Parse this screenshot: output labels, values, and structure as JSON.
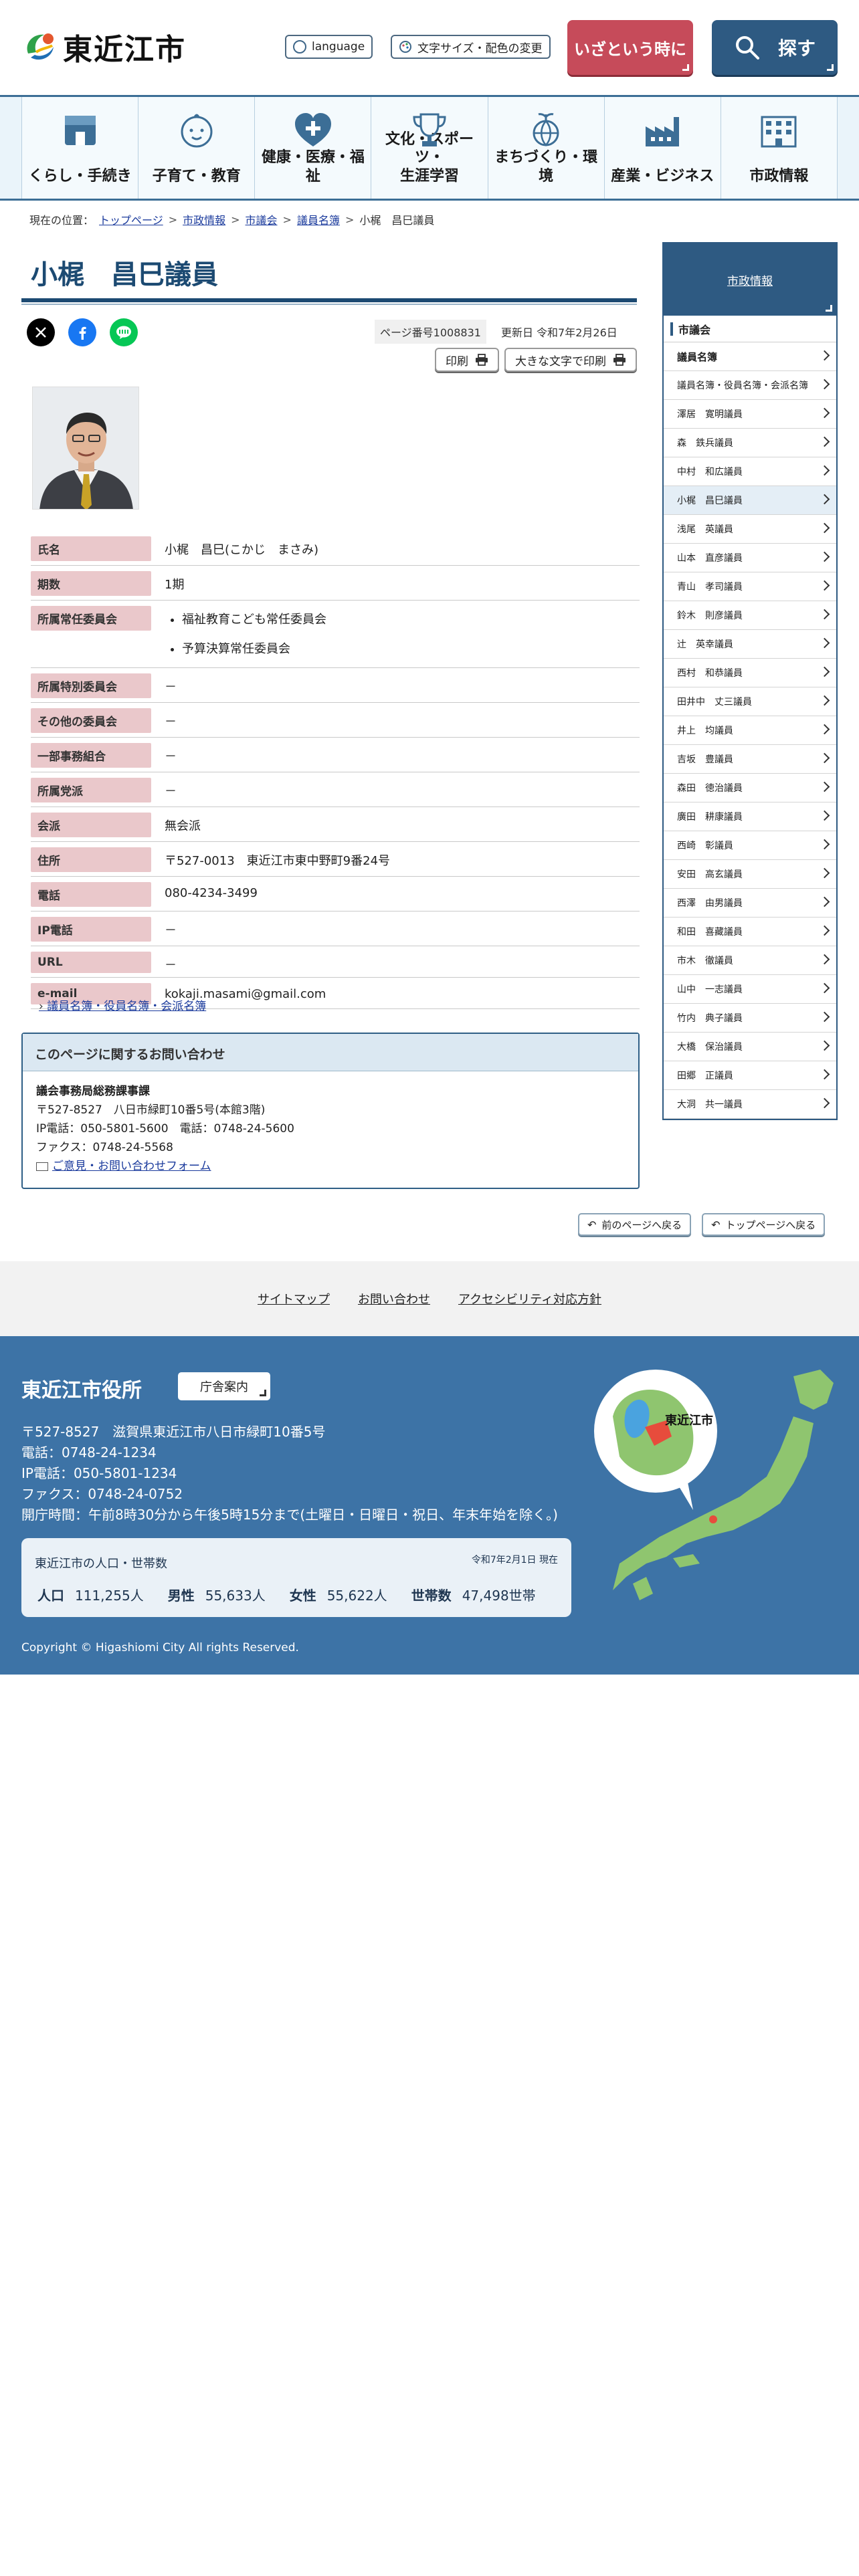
{
  "header": {
    "logo_text": "東近江市",
    "language_label": "language",
    "fontsize_label": "文字サイズ・配色の変更",
    "emergency_label": "いざという時に",
    "search_label": "探す"
  },
  "gnav": [
    {
      "label": "くらし・手続き",
      "icon": "house-icon"
    },
    {
      "label": "子育て・教育",
      "icon": "baby-face-icon"
    },
    {
      "label": "健康・医療・福祉",
      "icon": "heart-plus-icon"
    },
    {
      "label": "文化・スポーツ・\n生涯学習",
      "icon": "trophy-icon"
    },
    {
      "label": "まちづくり・環境",
      "icon": "globe-plant-icon"
    },
    {
      "label": "産業・ビジネス",
      "icon": "factory-icon"
    },
    {
      "label": "市政情報",
      "icon": "building-icon"
    }
  ],
  "breadcrumb": {
    "prefix": "現在の位置：",
    "items": [
      "トップページ",
      "市政情報",
      "市議会",
      "議員名簿"
    ],
    "current": "小梶　昌巳議員"
  },
  "page": {
    "title": "小梶　昌巳議員",
    "page_number": "ページ番号1008831",
    "updated": "更新日 令和7年2月26日",
    "print_label": "印刷",
    "print_large_label": "大きな文字で印刷"
  },
  "profile": [
    {
      "label": "氏名",
      "value": "小梶　昌巳(こかじ　まさみ)"
    },
    {
      "label": "期数",
      "value": "1期"
    },
    {
      "label": "所属常任委員会",
      "list": [
        "福祉教育こども常任委員会",
        "予算決算常任委員会"
      ]
    },
    {
      "label": "所属特別委員会",
      "value": "－"
    },
    {
      "label": "その他の委員会",
      "value": "－"
    },
    {
      "label": "一部事務組合",
      "value": "－"
    },
    {
      "label": "所属党派",
      "value": "－"
    },
    {
      "label": "会派",
      "value": "無会派"
    },
    {
      "label": "住所",
      "value": "〒527-0013　東近江市東中野町9番24号"
    },
    {
      "label": "電話",
      "value": "080-4234-3499"
    },
    {
      "label": "IP電話",
      "value": "－"
    },
    {
      "label": "URL",
      "value": "－"
    },
    {
      "label": "e-mail",
      "value": "kokaji.masami@gmail.com"
    }
  ],
  "related_link": "議員名簿・役員名簿・会派名簿",
  "contact": {
    "heading": "このページに関するお問い合わせ",
    "dept": "議会事務局総務課事課",
    "address": "〒527-8527　八日市緑町10番5号(本館3階)",
    "phone": "IP電話：050-5801-5600　電話：0748-24-5600",
    "fax": "ファクス：0748-24-5568",
    "form_link": "ご意見・お問い合わせフォーム"
  },
  "back_buttons": {
    "prev": "前のページへ戻る",
    "top": "トップページへ戻る"
  },
  "sidebar": {
    "heading": "市政情報",
    "sub": "市議会",
    "items": [
      {
        "label": "議員名簿",
        "bold": true
      },
      {
        "label": "議員名簿・役員名簿・会派名簿"
      },
      {
        "label": "澤居　寛明議員"
      },
      {
        "label": "森　鉄兵議員"
      },
      {
        "label": "中村　和広議員"
      },
      {
        "label": "小梶　昌巳議員",
        "active": true
      },
      {
        "label": "浅尾　英議員"
      },
      {
        "label": "山本　直彦議員"
      },
      {
        "label": "青山　孝司議員"
      },
      {
        "label": "鈴木　則彦議員"
      },
      {
        "label": "辻　英幸議員"
      },
      {
        "label": "西村　和恭議員"
      },
      {
        "label": "田井中　丈三議員"
      },
      {
        "label": "井上　均議員"
      },
      {
        "label": "吉坂　豊議員"
      },
      {
        "label": "森田　徳治議員"
      },
      {
        "label": "廣田　耕康議員"
      },
      {
        "label": "西崎　彰議員"
      },
      {
        "label": "安田　高玄議員"
      },
      {
        "label": "西澤　由男議員"
      },
      {
        "label": "和田　喜藏議員"
      },
      {
        "label": "市木　徹議員"
      },
      {
        "label": "山中　一志議員"
      },
      {
        "label": "竹内　典子議員"
      },
      {
        "label": "大橋　保治議員"
      },
      {
        "label": "田郷　正議員"
      },
      {
        "label": "大洞　共一議員"
      }
    ]
  },
  "footer_links": [
    "サイトマップ",
    "お問い合わせ",
    "アクセシビリティ対応方針"
  ],
  "footer": {
    "title": "東近江市役所",
    "guide_label": "庁舎案内",
    "address": "〒527-8527　滋賀県東近江市八日市緑町10番5号",
    "phone": "電話：0748-24-1234",
    "ip_phone": "IP電話：050-5801-1234",
    "fax": "ファクス：0748-24-0752",
    "hours": "開庁時間：午前8時30分から午後5時15分まで(土曜日・日曜日・祝日、年末年始を除く。)",
    "map_label": "東近江市",
    "population": {
      "title": "東近江市の人口・世帯数",
      "date": "令和7年2月1日 現在",
      "pop_label": "人口",
      "pop_value": "111,255人",
      "male_label": "男性",
      "male_value": "55,633人",
      "female_label": "女性",
      "female_value": "55,622人",
      "hh_label": "世帯数",
      "hh_value": "47,498世帯"
    },
    "copyright": "Copyright © Higashiomi City All rights Reserved."
  },
  "colors": {
    "primary": "#2e5a82",
    "emergency": "#c64b5a",
    "label_bg": "#eac8cb",
    "footer_bg": "#3d73a6"
  }
}
